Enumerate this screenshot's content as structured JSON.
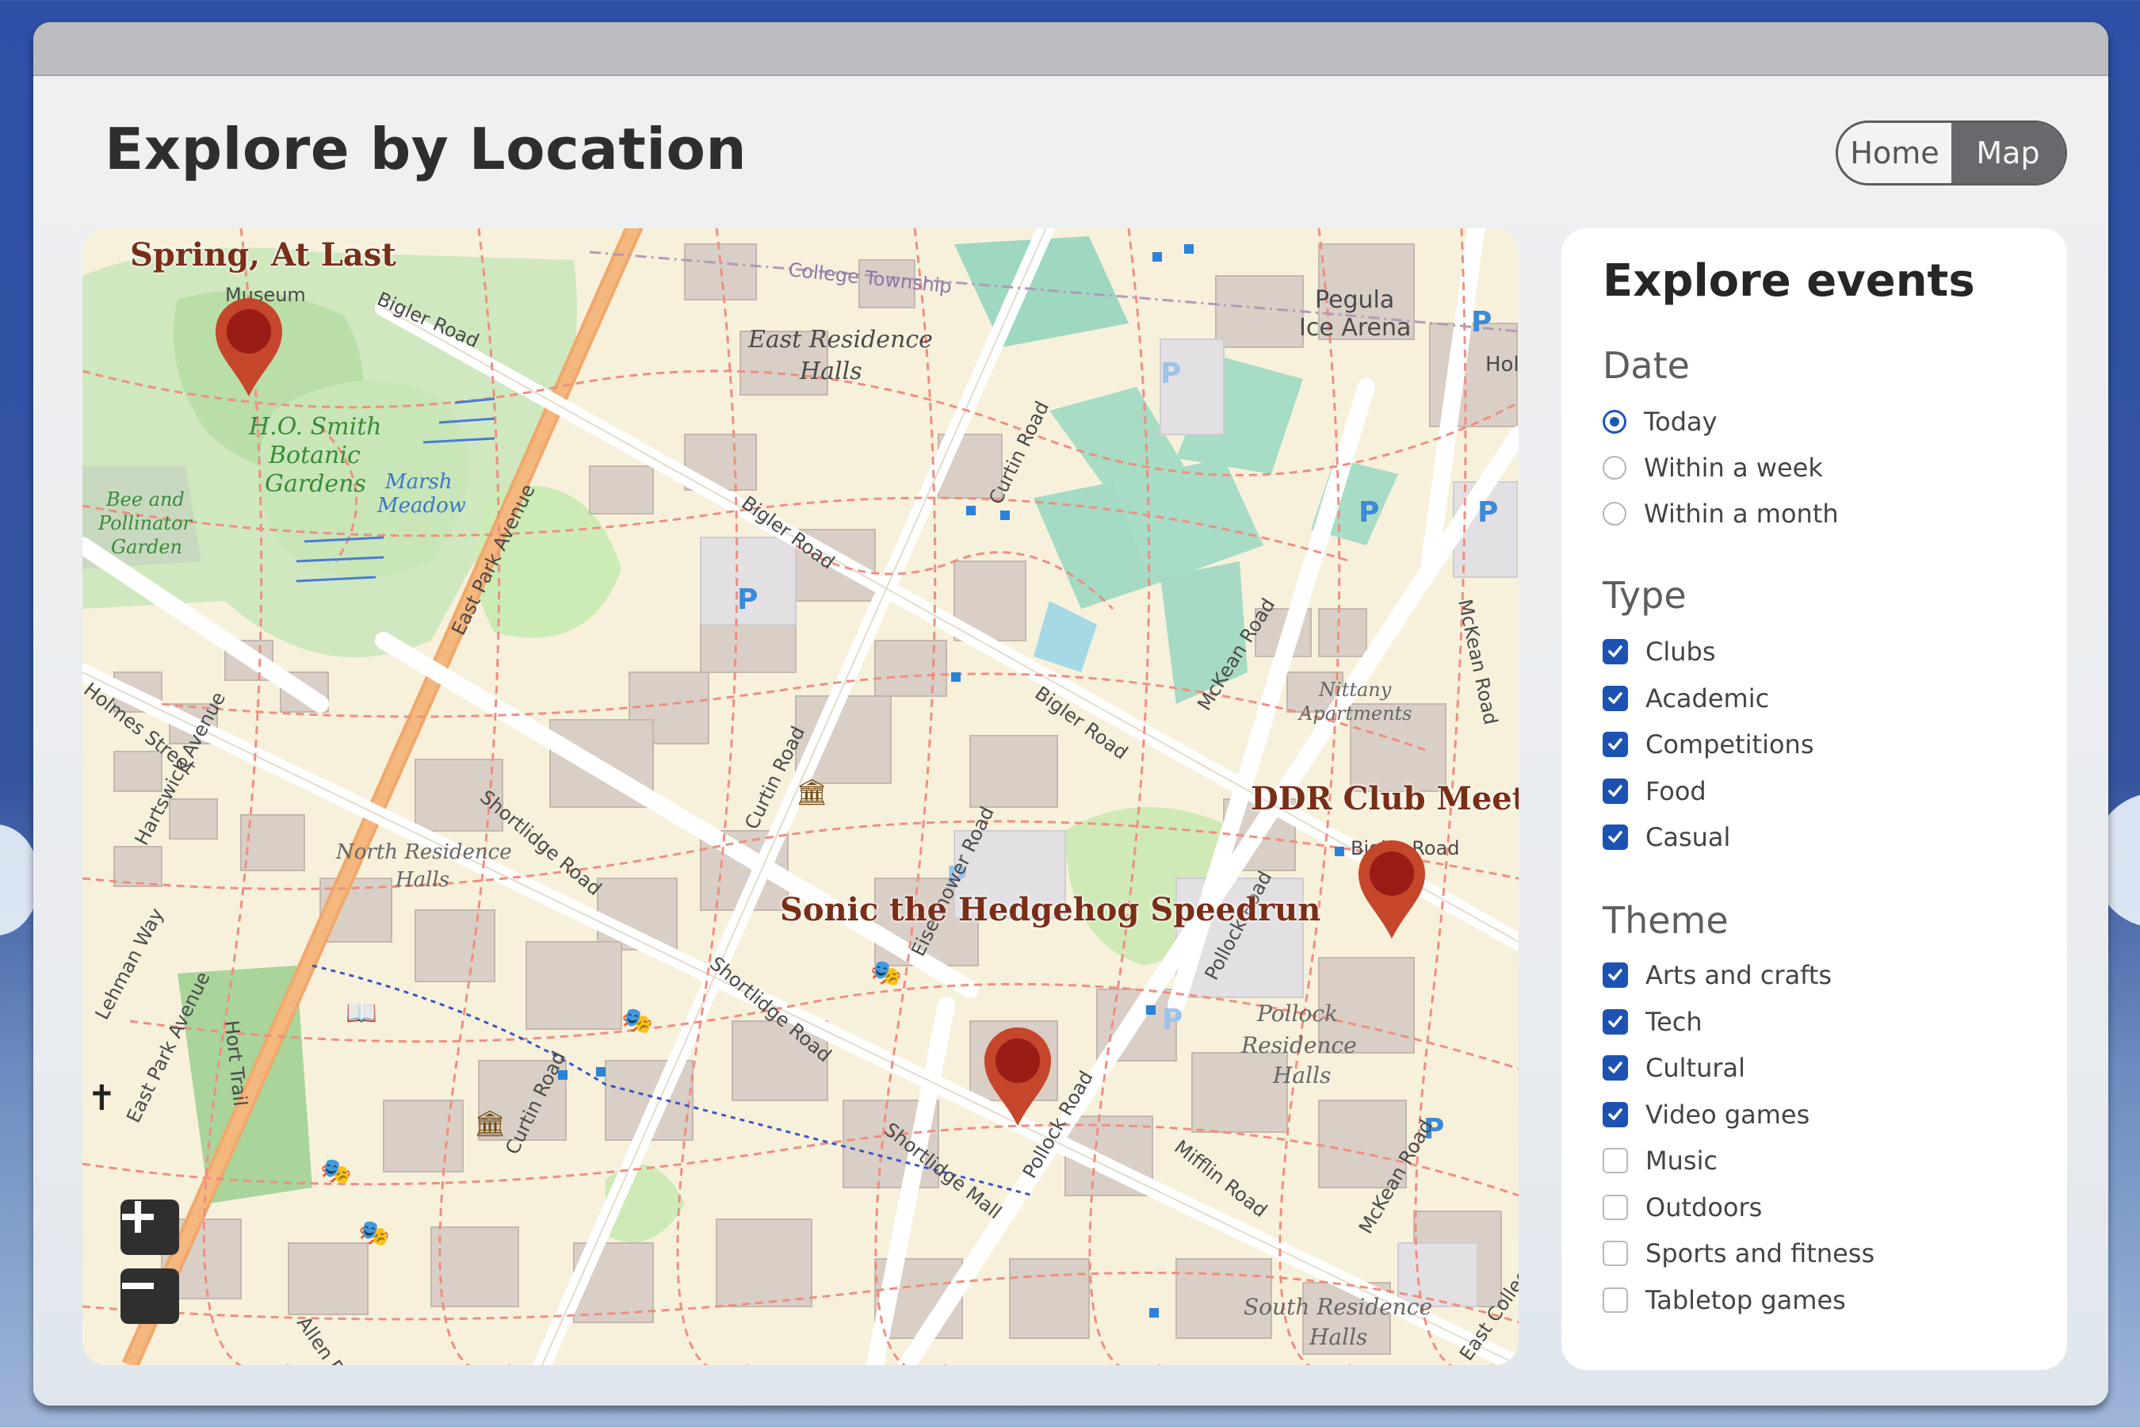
{
  "page": {
    "title": "Explore by Location",
    "nav": {
      "home_label": "Home",
      "map_label": "Map",
      "active": "Map"
    }
  },
  "map": {
    "labels": [
      "Museum",
      "Bigler Road",
      "College Township",
      "East Residence Halls",
      "Pegula Ice Arena",
      "H.O. Smith Botanic Gardens",
      "Marsh Meadow",
      "Bee and Pollinator Garden",
      "East Park Avenue",
      "Curtin Road",
      "Bigler Road",
      "McKean Road",
      "Nittany Apartments",
      "McKean Road",
      "Shortlidge Road",
      "North Residence Halls",
      "Hartswick Avenue",
      "Curtin Road",
      "Eisenhower Road",
      "Pollock Road",
      "Pollock Residence Halls",
      "Shortlidge Road",
      "Lehman Way",
      "East Park Avenue",
      "Hort Trail",
      "Curtin Road",
      "Shortlidge Mall",
      "Pollock Road",
      "Mifflin Road",
      "McKean Road",
      "South Residence Halls",
      "Bigler Road",
      "Holmes Street",
      "Allen Road",
      "East College"
    ],
    "events": [
      {
        "title": "Spring, At Last"
      },
      {
        "title": "DDR Club Meetin"
      },
      {
        "title": "Sonic the Hedgehog Speedrun"
      }
    ],
    "zoom_in_icon": "plus-icon",
    "zoom_out_icon": "minus-icon",
    "colors": {
      "pin": "#c0452a",
      "pin_dot": "#9a1c16",
      "event_label": "#7a2e18"
    }
  },
  "filters": {
    "heading": "Explore events",
    "date": {
      "title": "Date",
      "options": [
        {
          "label": "Today",
          "selected": true
        },
        {
          "label": "Within a week",
          "selected": false
        },
        {
          "label": "Within a month",
          "selected": false
        }
      ]
    },
    "type": {
      "title": "Type",
      "options": [
        {
          "label": "Clubs",
          "checked": true
        },
        {
          "label": "Academic",
          "checked": true
        },
        {
          "label": "Competitions",
          "checked": true
        },
        {
          "label": "Food",
          "checked": true
        },
        {
          "label": "Casual",
          "checked": true
        }
      ]
    },
    "theme": {
      "title": "Theme",
      "options": [
        {
          "label": "Arts and crafts",
          "checked": true
        },
        {
          "label": "Tech",
          "checked": true
        },
        {
          "label": "Cultural",
          "checked": true
        },
        {
          "label": "Video games",
          "checked": true
        },
        {
          "label": "Music",
          "checked": false
        },
        {
          "label": "Outdoors",
          "checked": false
        },
        {
          "label": "Sports and fitness",
          "checked": false
        },
        {
          "label": "Tabletop games",
          "checked": false
        }
      ]
    }
  },
  "accent": "#1c53b3"
}
